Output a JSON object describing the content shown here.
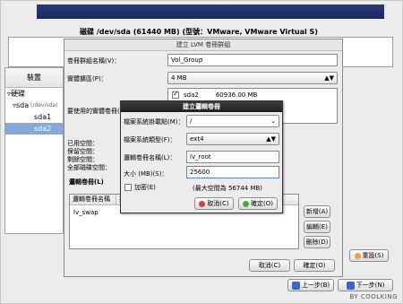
{
  "disk": {
    "title": "磁碟 /dev/sda (61440 MB) (型號：VMware, VMware Virtual S)"
  },
  "tree": {
    "header": "裝置",
    "items": [
      {
        "label": "硬碟"
      },
      {
        "label": "sda",
        "sub": "(/dev/sda)"
      },
      {
        "label": "sda1"
      },
      {
        "label": "sda2"
      }
    ]
  },
  "lvm_dialog": {
    "title": "建立 LVM 卷冊群組",
    "vg_name_label": "卷冊群組名稱(V)：",
    "vg_name_value": "Vol_Group",
    "pe_label": "實體擴區(P)：",
    "pe_value": "4 MB",
    "pv_label": "要使用的實體卷冊(",
    "pv_rows": [
      {
        "name": "sda2",
        "size": "60936.00 MB",
        "checked": true
      }
    ],
    "space": {
      "used": "已用空間：",
      "reserved": "保留空間：",
      "free": "剩餘空間：",
      "total": "全部磁碟空間："
    },
    "lv_section_label": "邏輯卷冊(L)",
    "lv_col_name": "邏輯卷冊名稱",
    "lv_col_mount": "掛",
    "lv_rows": [
      {
        "name": "lv_swap"
      }
    ],
    "add_button": "新增(A)",
    "edit_button": "編輯(E)",
    "delete_button": "刪除(D)",
    "cancel_button": "取消(C)",
    "ok_button": "確定(O)"
  },
  "lv_dialog": {
    "title": "建立邏輯卷冊",
    "mount_label": "檔案系統掛載點(M)：",
    "mount_value": "/",
    "fstype_label": "檔案系統類型(F)：",
    "fstype_value": "ext4",
    "lvname_label": "邏輯卷冊名稱(L)：",
    "lvname_value": "lv_root",
    "size_label": "大小 (MB)(S)：",
    "size_value": "25600",
    "encrypt_label": "加密(E)",
    "max_note": "(最大空間為 56744 MB)",
    "cancel_button": "取消(C)",
    "ok_button": "確定(O)"
  },
  "main": {
    "reset_button": "重設(S)",
    "back_button": "上一步(B)",
    "next_button": "下一步(N)"
  },
  "watermark": "BY COOLKING"
}
